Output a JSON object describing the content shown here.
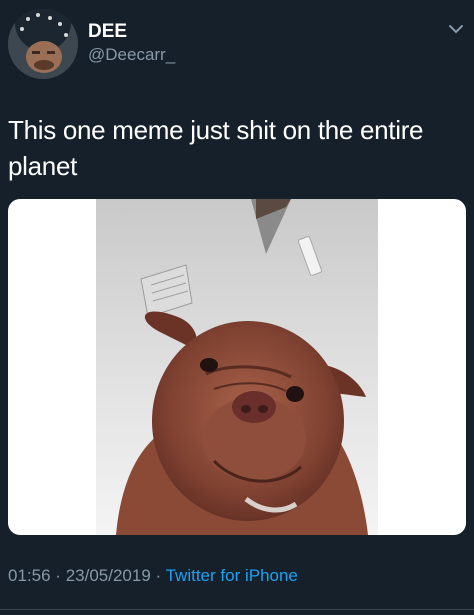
{
  "user": {
    "display_name": "DEE",
    "handle": "@Deecarr_",
    "avatar_icon": "profile-avatar",
    "menu_icon": "chevron-down-icon"
  },
  "tweet": {
    "text": "This one meme just shit on the entire planet",
    "media_type": "photo",
    "time": "01:56",
    "separator": "·",
    "date": "23/05/2019",
    "source": "Twitter for iPhone"
  },
  "colors": {
    "background": "#15202b",
    "secondary_text": "#8899a6",
    "link": "#1da1f2",
    "primary_text": "#ffffff"
  }
}
